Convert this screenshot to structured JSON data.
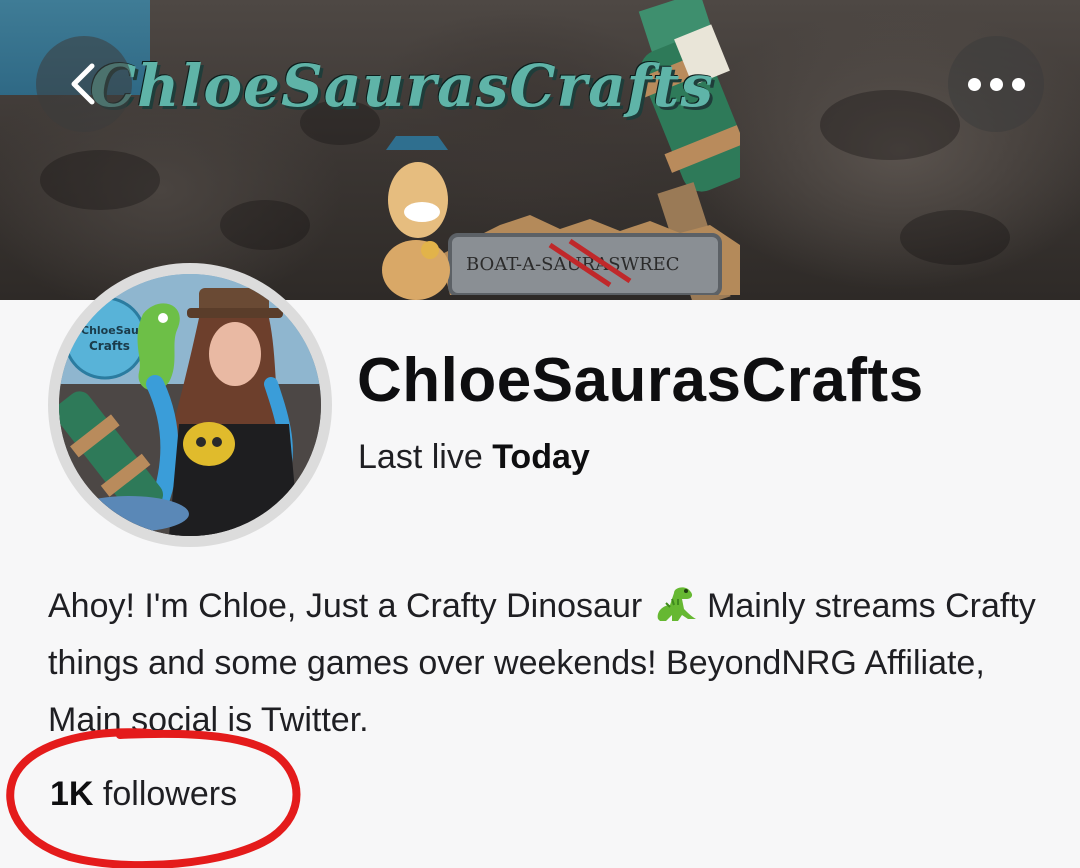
{
  "banner": {
    "logo_text": "ChloeSaurasCrafts",
    "sign_text": "BOAT-A-SAURASWREC"
  },
  "nav": {
    "back_icon": "chevron-left-icon",
    "more_icon": "more-horizontal-icon"
  },
  "channel": {
    "name": "ChloeSaurasCrafts",
    "last_live_label": "Last live",
    "last_live_value": "Today",
    "avatar_badge_text": "ChloeSauras Crafts"
  },
  "bio": {
    "line_before_emoji": "Ahoy! I'm Chloe, Just a Crafty Dinosaur",
    "emoji": "dinosaur-emoji",
    "line_after_emoji": "Mainly streams Crafty things and some games over weekends! BeyondNRG Affiliate, Main social is Twitter."
  },
  "stats": {
    "followers_count": "1K",
    "followers_label": "followers"
  },
  "annotation": {
    "color": "#e41b1b"
  },
  "colors": {
    "background": "#f7f7f8",
    "text": "#0e0e10",
    "logo": "#5fb4a8"
  }
}
